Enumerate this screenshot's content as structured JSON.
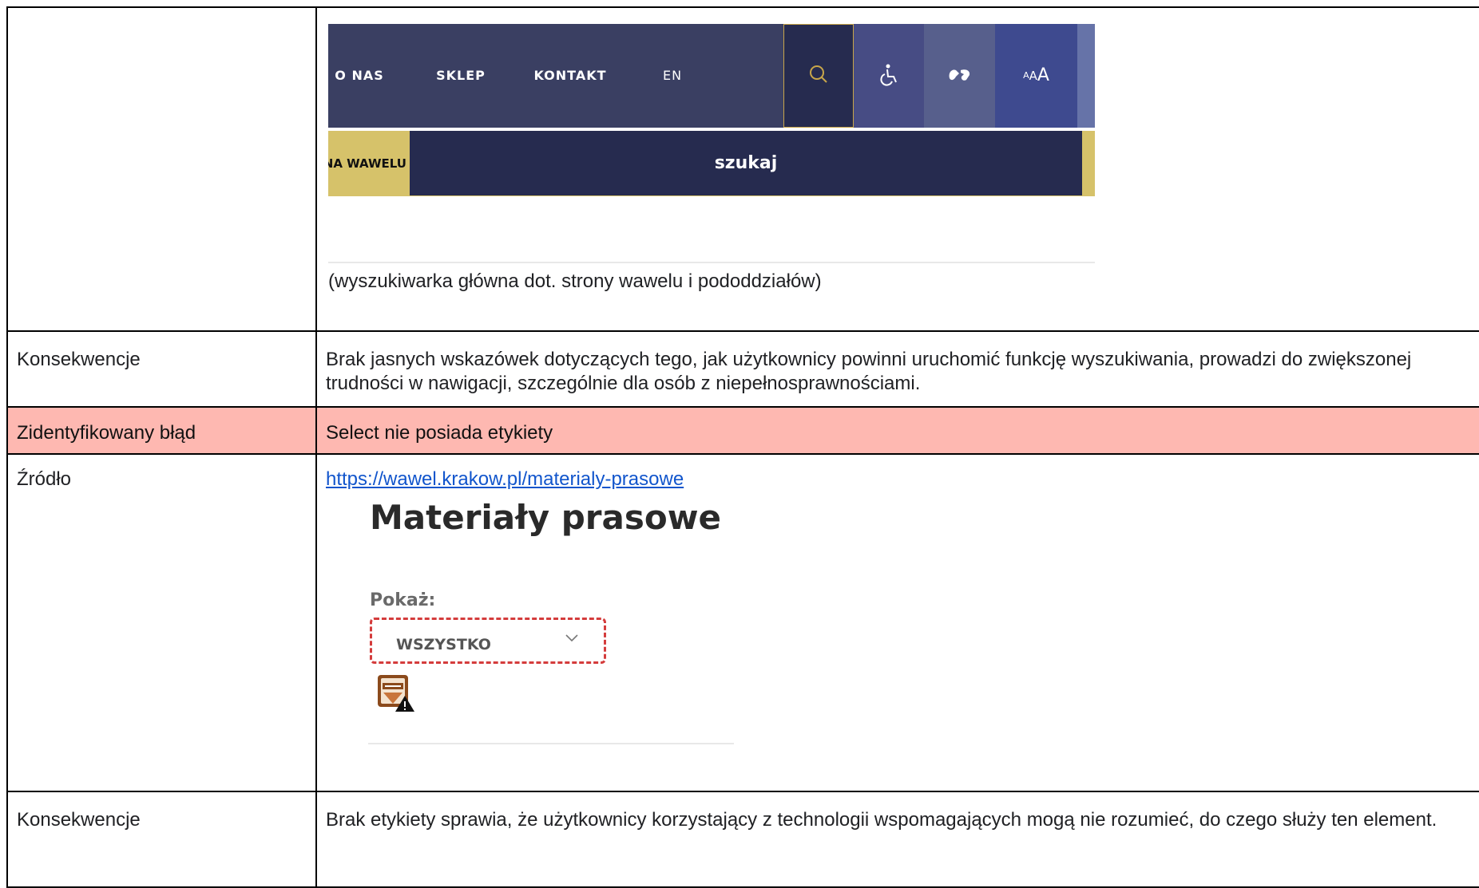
{
  "nav_screenshot": {
    "items": [
      "O NAS",
      "SKLEP",
      "KONTAKT",
      "EN"
    ],
    "font_size_label": "AAA",
    "strip_text": "W NA WAWELU",
    "search_button": "szukaj",
    "colors": {
      "bar": "#3a3f62",
      "search_bg": "#262b4f",
      "strip": "#d6c26a",
      "accent_border": "#c8a64a"
    }
  },
  "caption_search": "(wyszukiwarka główna dot. strony wawelu i pododdziałów)",
  "rows": {
    "cons1": {
      "label": "Konsekwencje",
      "text": "Brak jasnych wskazówek dotyczących tego, jak użytkownicy powinni uruchomić funkcję wyszukiwania, prowadzi do zwiększonej trudności w nawigacji, szczególnie dla osób z niepełnosprawnościami."
    },
    "error": {
      "label": "Zidentyfikowany błąd",
      "text": "Select nie posiada etykiety",
      "color": "#feb8b1"
    },
    "source": {
      "label": "Źródło",
      "url": "https://wawel.krakow.pl/materialy-prasowe"
    },
    "cons2": {
      "label": "Konsekwencje",
      "text": "Brak etykiety sprawia, że użytkownicy korzystający z technologii wspomagających mogą nie rozumieć, do czego służy ten element."
    }
  },
  "press_screenshot": {
    "title": "Materiały prasowe",
    "filter_label": "Pokaż:",
    "select_value": "WSZYSTKO",
    "highlight_color": "#d43c3c"
  }
}
